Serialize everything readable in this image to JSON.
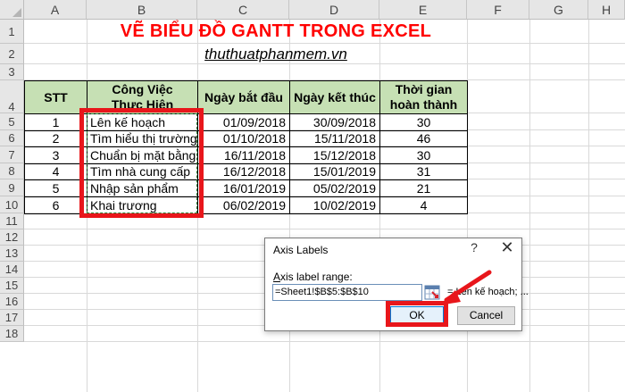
{
  "columns": [
    "A",
    "B",
    "C",
    "D",
    "E",
    "F",
    "G",
    "H"
  ],
  "rows": [
    "1",
    "2",
    "3",
    "4",
    "5",
    "6",
    "7",
    "8",
    "9",
    "10",
    "11",
    "12",
    "13",
    "14",
    "15",
    "16",
    "17",
    "18"
  ],
  "sheet": {
    "title": "VẼ BIỂU ĐỒ GANTT TRONG EXCEL",
    "subtitle": "thuthuatphanmem.vn"
  },
  "table": {
    "headers": [
      "STT",
      "Công Việc\nThực Hiện",
      "Ngày bắt đầu",
      "Ngày kết thúc",
      "Thời gian\nhoàn thành"
    ],
    "rows": [
      [
        "1",
        "Lên kế hoạch",
        "01/09/2018",
        "30/09/2018",
        "30"
      ],
      [
        "2",
        "Tìm hiểu thị trường",
        "01/10/2018",
        "15/11/2018",
        "46"
      ],
      [
        "3",
        "Chuẩn bị mặt bằng",
        "16/11/2018",
        "15/12/2018",
        "30"
      ],
      [
        "4",
        "Tìm nhà cung cấp",
        "16/12/2018",
        "15/01/2019",
        "31"
      ],
      [
        "5",
        "Nhập sản phẩm",
        "16/01/2019",
        "05/02/2019",
        "21"
      ],
      [
        "6",
        "Khai trương",
        "06/02/2019",
        "10/02/2019",
        "4"
      ]
    ]
  },
  "dialog": {
    "title": "Axis Labels",
    "help": "?",
    "close": "✕",
    "label_prefix": "A",
    "label_rest": "xis label range:",
    "input_value": "=Sheet1!$B$5:$B$10",
    "preview": "= Lên kế hoạch; ...",
    "ok": "OK",
    "cancel": "Cancel"
  },
  "colors": {
    "header_fill": "#c6e0b4",
    "title": "#ff0000",
    "highlight": "#e8161b",
    "marquee": "#2e7d32"
  }
}
